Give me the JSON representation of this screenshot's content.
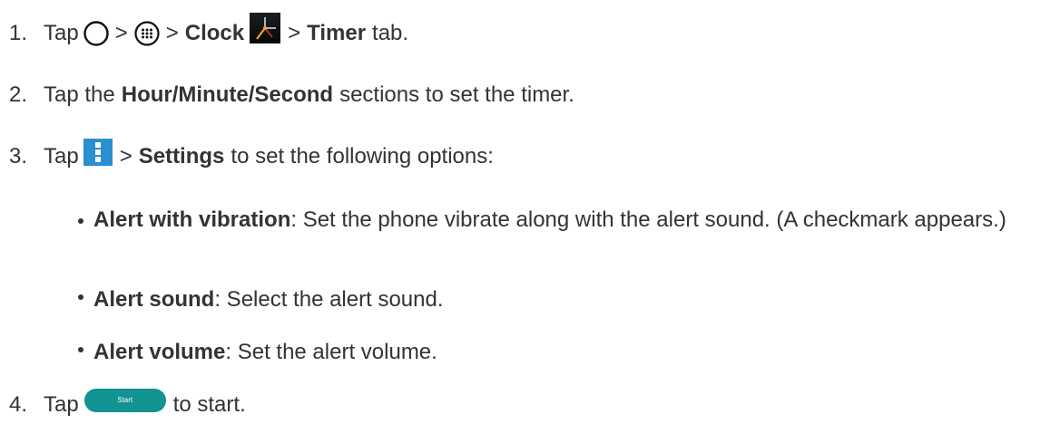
{
  "steps": [
    {
      "number": "1.",
      "parts": [
        "Tap",
        ">",
        ">",
        "Clock",
        ">",
        "Timer",
        "tab."
      ]
    },
    {
      "number": "2.",
      "parts": [
        "Tap the",
        "Hour/Minute/Second",
        "sections to set the timer."
      ]
    },
    {
      "number": "3.",
      "parts": [
        "Tap",
        ">",
        "Settings",
        "to set the following options:"
      ]
    },
    {
      "number": "4.",
      "parts": [
        "Tap",
        "to start."
      ]
    }
  ],
  "bullets": [
    {
      "term": "Alert with vibration",
      "text": ": Set the phone vibrate along with the alert sound. (A checkmark appears.)"
    },
    {
      "term": "Alert sound",
      "text": ": Select the alert sound."
    },
    {
      "term": "Alert volume",
      "text": ": Set the alert volume."
    }
  ],
  "buttons": {
    "start_label": "Start"
  },
  "icons": {
    "home": "home-circle-icon",
    "apps": "apps-grid-icon",
    "clock": "clock-app-icon",
    "menu": "more-options-icon"
  },
  "colors": {
    "text": "#333333",
    "start_button": "#109391",
    "menu_icon_bg": "#2a8fd1"
  }
}
